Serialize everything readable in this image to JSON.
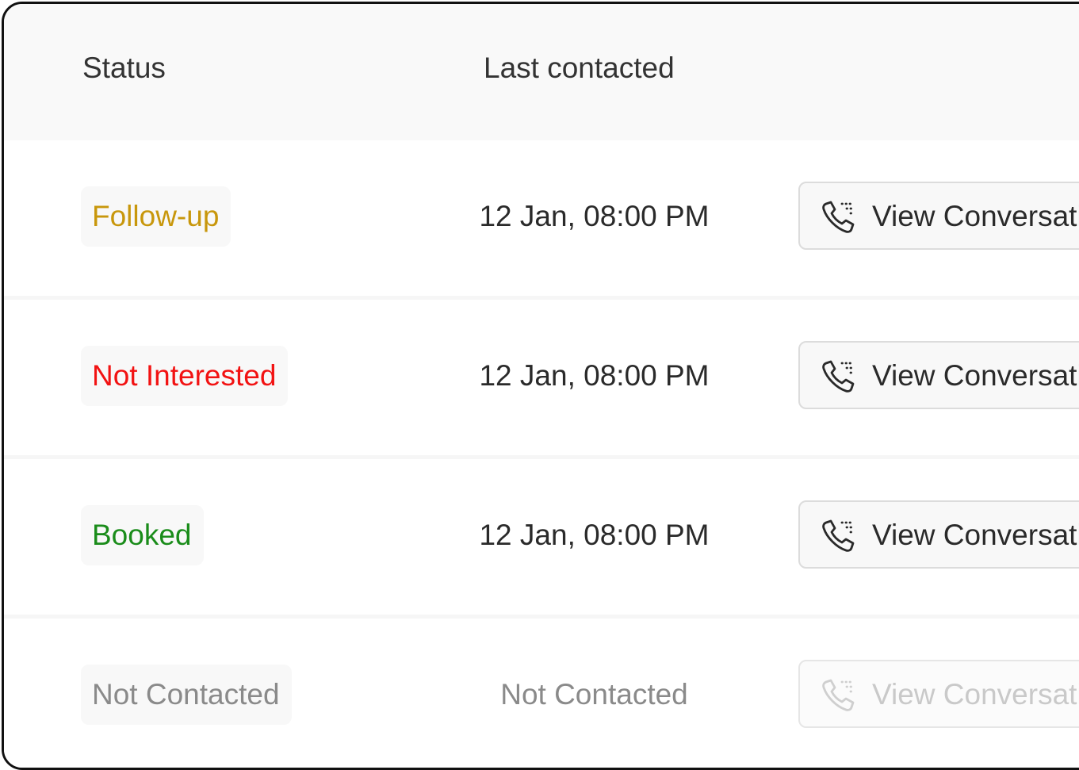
{
  "table": {
    "columns": {
      "status": "Status",
      "last_contacted": "Last contacted"
    },
    "rows": [
      {
        "status": "Follow-up",
        "status_color": "#c8970c",
        "last_contacted": "12 Jan, 08:00 PM",
        "action_label": "View Conversation",
        "action_enabled": true
      },
      {
        "status": "Not Interested",
        "status_color": "#f21212",
        "last_contacted": "12 Jan, 08:00 PM",
        "action_label": "View Conversation",
        "action_enabled": true
      },
      {
        "status": "Booked",
        "status_color": "#1a8c1a",
        "last_contacted": "12 Jan, 08:00 PM",
        "action_label": "View Conversation",
        "action_enabled": true
      },
      {
        "status": "Not Contacted",
        "status_color": "#8a8a8a",
        "last_contacted": "Not Contacted",
        "action_label": "View Conversation",
        "action_enabled": false
      }
    ],
    "action_icon": "phone-call-icon"
  }
}
